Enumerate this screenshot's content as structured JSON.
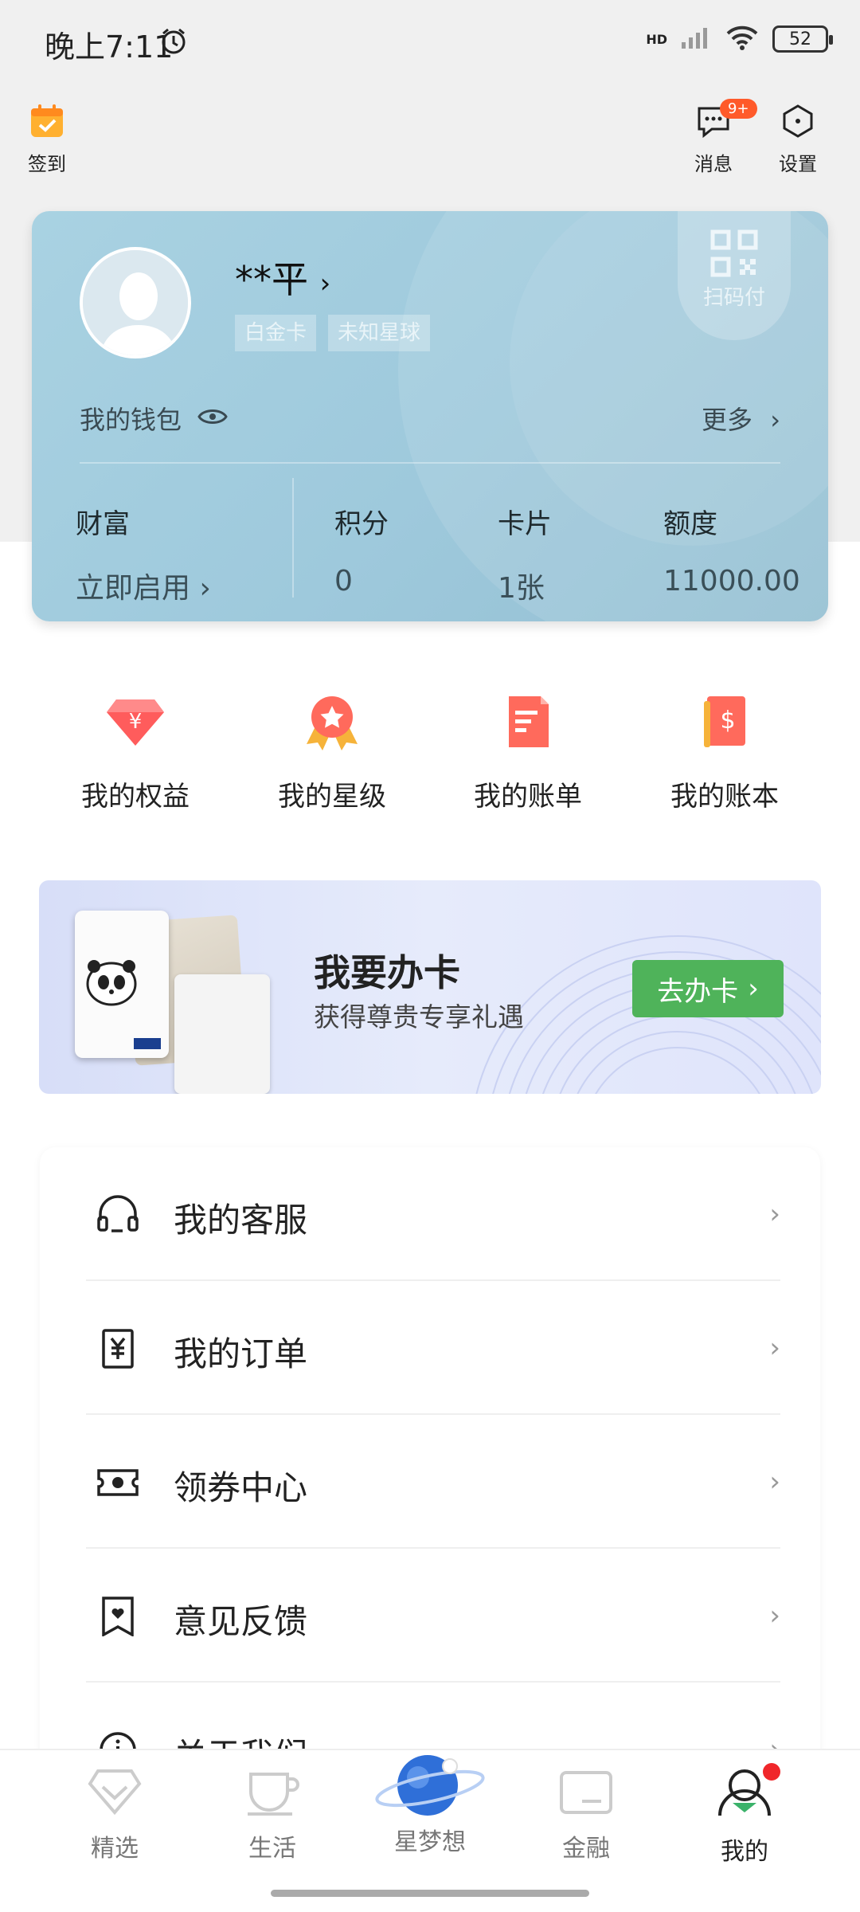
{
  "status_bar": {
    "time": "晚上7:11",
    "network": "HD",
    "battery": "52"
  },
  "top_nav": {
    "checkin_label": "签到",
    "messages_label": "消息",
    "messages_badge": "9+",
    "settings_label": "设置"
  },
  "card": {
    "username": "**平",
    "tags": [
      "白金卡",
      "未知星球"
    ],
    "qr_label": "扫码付",
    "wallet_label": "我的钱包",
    "more_label": "更多",
    "stats": [
      {
        "label": "财富",
        "value": "立即启用"
      },
      {
        "label": "积分",
        "value": "0"
      },
      {
        "label": "卡片",
        "value": "1张"
      },
      {
        "label": "额度",
        "value": "11000.00"
      }
    ]
  },
  "quick_actions": [
    {
      "label": "我的权益",
      "icon": "diamond-yuan-icon"
    },
    {
      "label": "我的星级",
      "icon": "star-medal-icon"
    },
    {
      "label": "我的账单",
      "icon": "bill-icon"
    },
    {
      "label": "我的账本",
      "icon": "ledger-book-icon"
    }
  ],
  "banner": {
    "title": "我要办卡",
    "subtitle": "获得尊贵专享礼遇",
    "button": "去办卡"
  },
  "menu": [
    {
      "label": "我的客服",
      "icon": "headset-icon"
    },
    {
      "label": "我的订单",
      "icon": "order-yuan-icon"
    },
    {
      "label": "领券中心",
      "icon": "ticket-icon"
    },
    {
      "label": "意见反馈",
      "icon": "feedback-icon"
    },
    {
      "label": "关于我们",
      "icon": "info-icon"
    }
  ],
  "tabs": [
    {
      "label": "精选",
      "icon": "diamond-outline-icon"
    },
    {
      "label": "生活",
      "icon": "cup-icon"
    },
    {
      "label": "星梦想",
      "icon": "planet-icon"
    },
    {
      "label": "金融",
      "icon": "card-icon"
    },
    {
      "label": "我的",
      "icon": "user-icon",
      "active": true
    }
  ],
  "colors": {
    "accent_green": "#4fb35a",
    "card_blue": "#9ec9dc",
    "badge_orange": "#ff5a2a"
  }
}
